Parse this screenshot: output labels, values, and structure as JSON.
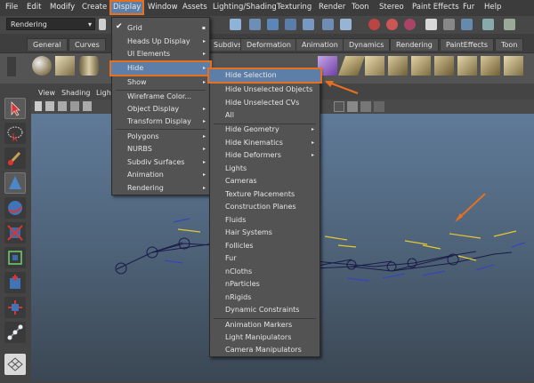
{
  "menubar": {
    "items": [
      {
        "label": "File"
      },
      {
        "label": "Edit"
      },
      {
        "label": "Modify"
      },
      {
        "label": "Create"
      },
      {
        "label": "Display"
      },
      {
        "label": "Window"
      },
      {
        "label": "Assets"
      },
      {
        "label": "Lighting/Shading"
      },
      {
        "label": "Texturing"
      },
      {
        "label": "Render"
      },
      {
        "label": "Toon"
      },
      {
        "label": "Stereo"
      },
      {
        "label": "Paint Effects"
      },
      {
        "label": "Fur"
      },
      {
        "label": "Help"
      }
    ]
  },
  "statusline": {
    "mode": "Rendering"
  },
  "shelf_tabs": [
    "General",
    "Curves",
    "Subdivs",
    "Deformation",
    "Animation",
    "Dynamics",
    "Rendering",
    "PaintEffects",
    "Toon"
  ],
  "viewport_menu": [
    "View",
    "Shading",
    "Ligh"
  ],
  "display_menu": {
    "items": [
      {
        "label": "Grid",
        "checked": true
      },
      {
        "label": "Heads Up Display",
        "submenu": true
      },
      {
        "label": "UI Elements",
        "submenu": true
      },
      {
        "label": "Hide",
        "submenu": true,
        "highlighted": true
      },
      {
        "label": "Show",
        "submenu": true
      },
      {
        "label": "Wireframe Color..."
      },
      {
        "label": "Object Display",
        "submenu": true
      },
      {
        "label": "Transform Display",
        "submenu": true
      },
      {
        "label": "Polygons",
        "submenu": true
      },
      {
        "label": "NURBS",
        "submenu": true
      },
      {
        "label": "Subdiv Surfaces",
        "submenu": true
      },
      {
        "label": "Animation",
        "submenu": true
      },
      {
        "label": "Rendering",
        "submenu": true
      }
    ]
  },
  "hide_menu": {
    "items": [
      {
        "label": "Hide Selection",
        "highlighted": true
      },
      {
        "label": "Hide Unselected Objects"
      },
      {
        "label": "Hide Unselected CVs"
      },
      {
        "label": "All"
      },
      {
        "label": "Hide Geometry",
        "submenu": true
      },
      {
        "label": "Hide Kinematics",
        "submenu": true
      },
      {
        "label": "Hide Deformers",
        "submenu": true
      },
      {
        "label": "Lights"
      },
      {
        "label": "Cameras"
      },
      {
        "label": "Texture Placements"
      },
      {
        "label": "Construction Planes"
      },
      {
        "label": "Fluids"
      },
      {
        "label": "Hair Systems"
      },
      {
        "label": "Follicles"
      },
      {
        "label": "Fur"
      },
      {
        "label": "nCloths"
      },
      {
        "label": "nParticles"
      },
      {
        "label": "nRigids"
      },
      {
        "label": "Dynamic Constraints"
      },
      {
        "label": "Animation Markers"
      },
      {
        "label": "Light Manipulators"
      },
      {
        "label": "Camera Manipulators"
      }
    ]
  },
  "glyphs": {
    "arrow": "▸",
    "dropdown": "▾",
    "check": "✔"
  },
  "colors": {
    "highlight": "#5d7fa7",
    "annotation": "#e6701f",
    "menu_bg": "#535353",
    "viewport_top": "#5f7a98",
    "viewport_bottom": "#3b4753"
  }
}
